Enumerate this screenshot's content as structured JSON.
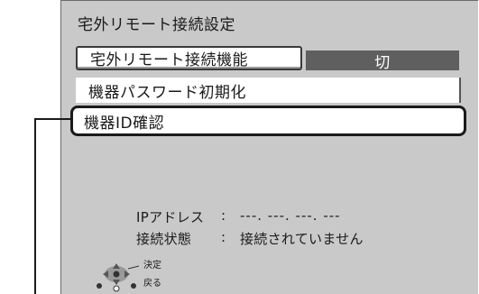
{
  "screen": {
    "title": "宅外リモート接続設定"
  },
  "menu": {
    "function_label": "宅外リモート接続機能",
    "function_value": "切",
    "password_reset_label": "機器パスワード初期化",
    "id_confirm_label": "機器ID確認"
  },
  "info": {
    "ip_label": "IPアドレス",
    "ip_value": "---. ---. ---. ---",
    "status_label": "接続状態",
    "status_value": "接続されていません",
    "colon": ":"
  },
  "nav_hint": {
    "enter_label": "決定",
    "back_label": "戻る",
    "icon": "remote-dpad-icon"
  },
  "colors": {
    "panel_bg": "#c9c9c9",
    "value_bg": "#5f5f5f",
    "highlight_border": "#1a1a1a"
  }
}
